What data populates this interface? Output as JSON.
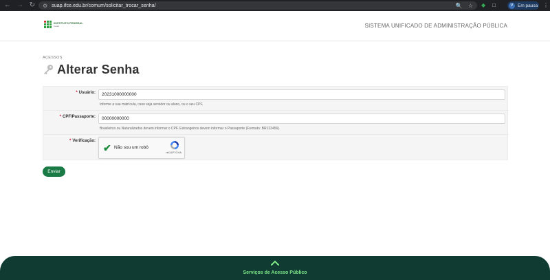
{
  "browser": {
    "url": "suap.ifce.edu.br/comum/solicitar_trocar_senha/",
    "profile_initial": "V",
    "profile_status": "Em pausa"
  },
  "header": {
    "logo_title": "INSTITUTO FEDERAL",
    "logo_subtitle": "Ceará",
    "system_name": "SISTEMA UNIFICADO DE ADMINISTRAÇÃO PÚBLICA"
  },
  "breadcrumb": "ACESSOS",
  "page_title": "Alterar Senha",
  "form": {
    "usuario": {
      "label": "Usuário:",
      "value": "20231000000000",
      "help": "Informe a sua matrícula, caso seja servidor ou aluno, ou o seu CPF."
    },
    "cpf": {
      "label": "CPF/Passaporte:",
      "value": "00000000000",
      "help": "Brasileiros ou Naturalizados devem informar o CPF. Estrangeiros devem informar o Passaporte (Formato: BR123456)."
    },
    "verificacao": {
      "label": "Verificação:",
      "captcha_text": "Não sou um robô",
      "captcha_brand": "reCAPTCHA"
    },
    "required_marker": "*",
    "submit_label": "Enviar"
  },
  "footer": {
    "text": "Serviços de Acesso Público"
  },
  "colors": {
    "primary_green": "#1a7a45",
    "footer_bg": "#0f3b33",
    "footer_text": "#7ee787"
  }
}
